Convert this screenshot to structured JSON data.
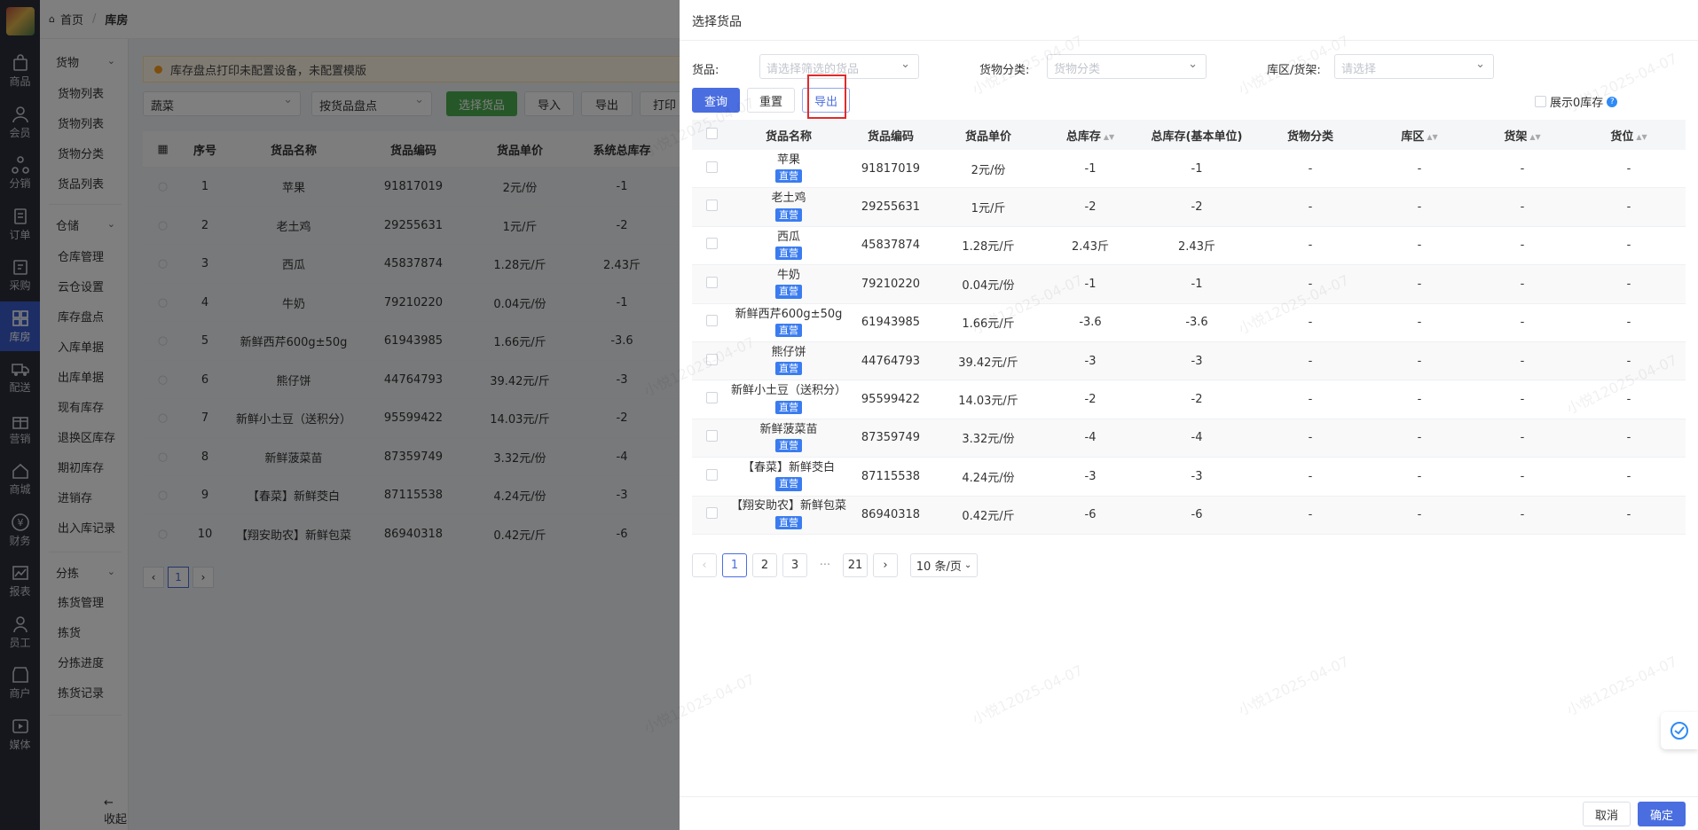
{
  "nav": {
    "rail": [
      {
        "label": "商品",
        "icon": "bag-icon"
      },
      {
        "label": "会员",
        "icon": "user-icon"
      },
      {
        "label": "分销",
        "icon": "share-icon"
      },
      {
        "label": "订单",
        "icon": "order-icon"
      },
      {
        "label": "采购",
        "icon": "purchase-icon"
      },
      {
        "label": "库房",
        "icon": "warehouse-icon",
        "active": true
      },
      {
        "label": "配送",
        "icon": "truck-icon"
      },
      {
        "label": "营销",
        "icon": "gift-icon"
      },
      {
        "label": "商城",
        "icon": "home-icon"
      },
      {
        "label": "财务",
        "icon": "yen-icon"
      },
      {
        "label": "报表",
        "icon": "chart-icon"
      },
      {
        "label": "员工",
        "icon": "staff-icon"
      },
      {
        "label": "商户",
        "icon": "shop-icon"
      },
      {
        "label": "媒体",
        "icon": "play-icon"
      }
    ],
    "groups": {
      "goods": {
        "label": "货物",
        "items": [
          "货物列表",
          "货物列表",
          "货物分类",
          "货品列表"
        ]
      },
      "storage": {
        "label": "仓储",
        "items": [
          "仓库管理",
          "云仓设置",
          "库存盘点",
          "入库单据",
          "出库单据",
          "现有库存",
          "退换区库存",
          "期初库存",
          "进销存",
          "出入库记录"
        ]
      },
      "pick": {
        "label": "分拣",
        "items": [
          "拣货管理",
          "拣货",
          "分拣进度",
          "拣货记录"
        ]
      }
    },
    "collapse": "收起"
  },
  "breadcrumb": {
    "home": "首页",
    "sep": "/",
    "current": "库房"
  },
  "background": {
    "notice": "库存盘点打印未配置设备，未配置模版",
    "select1": "蔬菜",
    "select2": "按货品盘点",
    "buttons": [
      "选择货品",
      "导入",
      "导出",
      "打印"
    ],
    "headers": [
      "序号",
      "货品名称",
      "货品编码",
      "货品单价",
      "系统总库存"
    ],
    "rows": [
      [
        "1",
        "苹果",
        "91817019",
        "2元/份",
        "-1"
      ],
      [
        "2",
        "老土鸡",
        "29255631",
        "1元/斤",
        "-2"
      ],
      [
        "3",
        "西瓜",
        "45837874",
        "1.28元/斤",
        "2.43斤"
      ],
      [
        "4",
        "牛奶",
        "79210220",
        "0.04元/份",
        "-1"
      ],
      [
        "5",
        "新鲜西芹600g±50g",
        "61943985",
        "1.66元/斤",
        "-3.6"
      ],
      [
        "6",
        "熊仔饼",
        "44764793",
        "39.42元/斤",
        "-3"
      ],
      [
        "7",
        "新鲜小土豆（送积分）",
        "95599422",
        "14.03元/斤",
        "-2"
      ],
      [
        "8",
        "新鲜菠菜苗",
        "87359749",
        "3.32元/份",
        "-4"
      ],
      [
        "9",
        "【春菜】新鲜茭白",
        "87115538",
        "4.24元/份",
        "-3"
      ],
      [
        "10",
        "【翔安助农】新鲜包菜",
        "86940318",
        "0.42元/斤",
        "-6"
      ]
    ],
    "page": "1"
  },
  "drawer": {
    "title": "选择货品",
    "filters": {
      "goods_label": "货品:",
      "goods_placeholder": "请选择筛选的货品",
      "category_label": "货物分类:",
      "category_placeholder": "货物分类",
      "location_label": "库区/货架:",
      "location_placeholder": "请选择"
    },
    "buttons": {
      "query": "查询",
      "reset": "重置",
      "export": "导出"
    },
    "show_zero": "展示0库存",
    "columns": [
      "货品名称",
      "货品编码",
      "货品单价",
      "总库存",
      "总库存(基本单位)",
      "货物分类",
      "库区",
      "货架",
      "货位"
    ],
    "tag": "直营",
    "rows": [
      {
        "name": "苹果",
        "code": "91817019",
        "price": "2元/份",
        "stock": "-1",
        "base": "-1",
        "cat": "-",
        "zone": "-",
        "shelf": "-",
        "slot": "-"
      },
      {
        "name": "老土鸡",
        "code": "29255631",
        "price": "1元/斤",
        "stock": "-2",
        "base": "-2",
        "cat": "-",
        "zone": "-",
        "shelf": "-",
        "slot": "-"
      },
      {
        "name": "西瓜",
        "code": "45837874",
        "price": "1.28元/斤",
        "stock": "2.43斤",
        "base": "2.43斤",
        "cat": "-",
        "zone": "-",
        "shelf": "-",
        "slot": "-"
      },
      {
        "name": "牛奶",
        "code": "79210220",
        "price": "0.04元/份",
        "stock": "-1",
        "base": "-1",
        "cat": "-",
        "zone": "-",
        "shelf": "-",
        "slot": "-"
      },
      {
        "name": "新鲜西芹600g±50g",
        "code": "61943985",
        "price": "1.66元/斤",
        "stock": "-3.6",
        "base": "-3.6",
        "cat": "-",
        "zone": "-",
        "shelf": "-",
        "slot": "-"
      },
      {
        "name": "熊仔饼",
        "code": "44764793",
        "price": "39.42元/斤",
        "stock": "-3",
        "base": "-3",
        "cat": "-",
        "zone": "-",
        "shelf": "-",
        "slot": "-"
      },
      {
        "name": "新鲜小土豆（送积分）",
        "code": "95599422",
        "price": "14.03元/斤",
        "stock": "-2",
        "base": "-2",
        "cat": "-",
        "zone": "-",
        "shelf": "-",
        "slot": "-"
      },
      {
        "name": "新鲜菠菜苗",
        "code": "87359749",
        "price": "3.32元/份",
        "stock": "-4",
        "base": "-4",
        "cat": "-",
        "zone": "-",
        "shelf": "-",
        "slot": "-"
      },
      {
        "name": "【春菜】新鲜茭白",
        "code": "87115538",
        "price": "4.24元/份",
        "stock": "-3",
        "base": "-3",
        "cat": "-",
        "zone": "-",
        "shelf": "-",
        "slot": "-"
      },
      {
        "name": "【翔安助农】新鲜包菜",
        "code": "86940318",
        "price": "0.42元/斤",
        "stock": "-6",
        "base": "-6",
        "cat": "-",
        "zone": "-",
        "shelf": "-",
        "slot": "-"
      }
    ],
    "pager": {
      "pages": [
        "1",
        "2",
        "3"
      ],
      "ellipsis": "···",
      "last": "21",
      "page_size": "10 条/页"
    },
    "footer": {
      "cancel": "取消",
      "confirm": "确定"
    }
  },
  "watermark": "小悦12025-04-07",
  "colors": {
    "primary": "#4a6ee0",
    "tag": "#3a7cf0",
    "highlight": "#e02b2b",
    "sidebar": "#2b2f3a"
  }
}
